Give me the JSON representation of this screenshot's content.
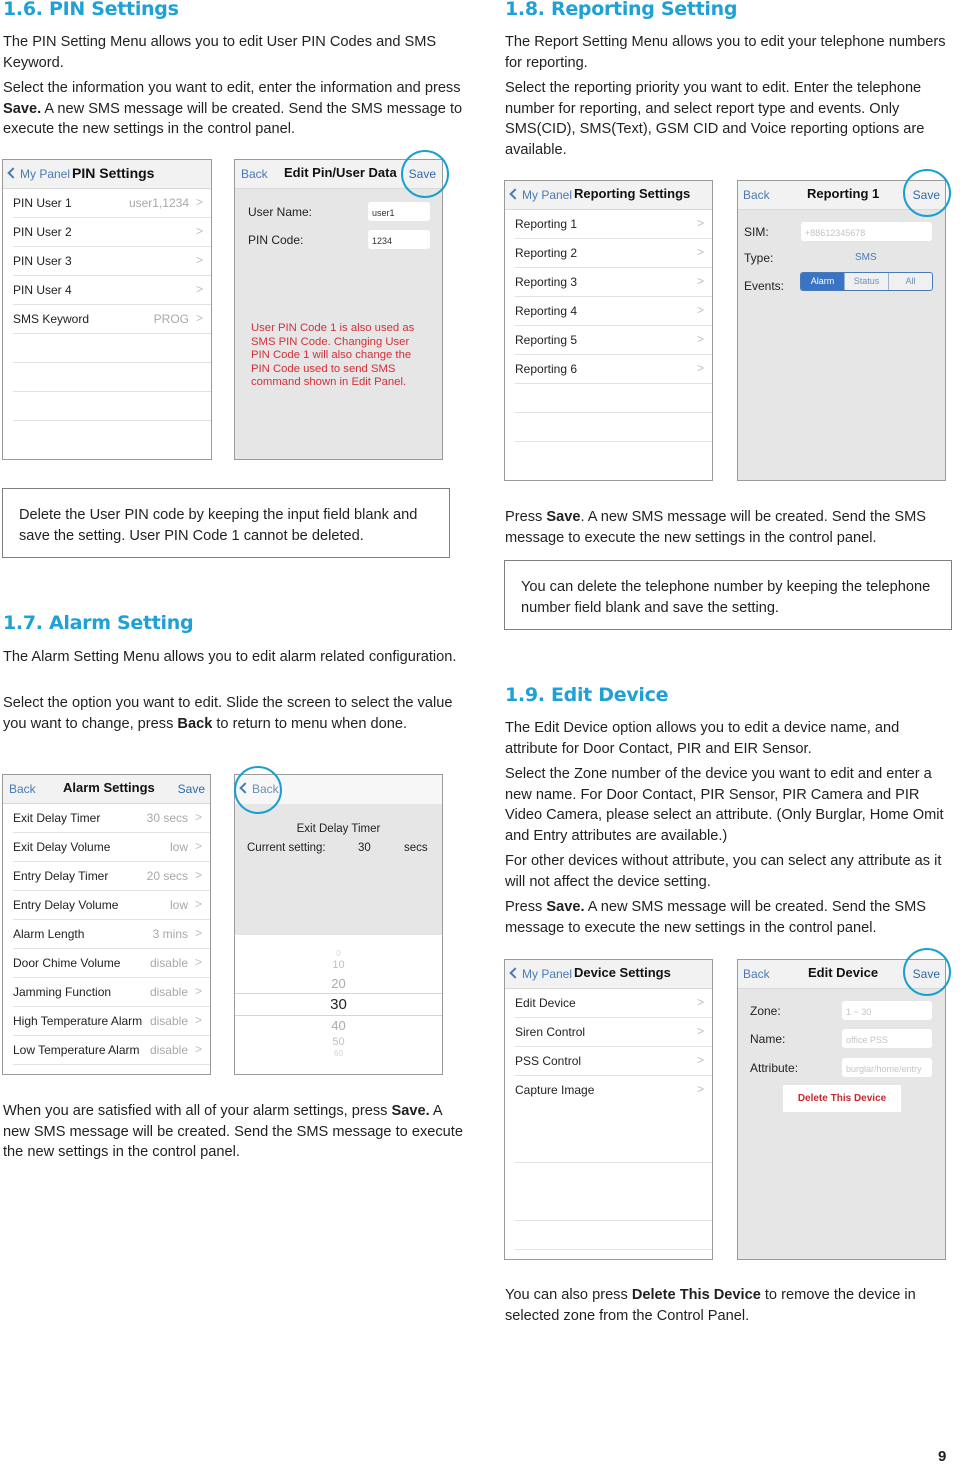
{
  "page_number": "9",
  "s16": {
    "heading": "1.6. PIN Settings",
    "para1": "The PIN Setting Menu allows you to edit User PIN Codes and SMS Keyword.",
    "para2_pre": "Select the information you want to edit, enter the information and press ",
    "para2_bold": "Save.",
    "para2_post": " A new SMS message will be created. Send the SMS message to execute the new settings in the control panel.",
    "note": "Delete the User PIN code by keeping the input field blank and save the setting. User PIN Code 1 cannot be deleted.",
    "list_screen": {
      "back": "My Panel",
      "title": "PIN Settings",
      "rows": [
        {
          "label": "PIN User 1",
          "value": "user1,1234"
        },
        {
          "label": "PIN User 2",
          "value": ""
        },
        {
          "label": "PIN User 3",
          "value": ""
        },
        {
          "label": "PIN User 4",
          "value": ""
        },
        {
          "label": "SMS Keyword",
          "value": "PROG"
        }
      ]
    },
    "edit_screen": {
      "back": "Back",
      "title": "Edit Pin/User Data",
      "save": "Save",
      "user_name_label": "User Name:",
      "user_name_value": "user1",
      "pin_code_label": "PIN Code:",
      "pin_code_value": "1234",
      "warning": "User PIN Code 1 is also used as SMS PIN Code. Changing User PIN Code 1 will also change the PIN Code used to send SMS command shown in Edit Panel."
    }
  },
  "s17": {
    "heading": "1.7. Alarm Setting",
    "para1": "The Alarm Setting Menu allows you to edit alarm related configuration.",
    "para2_pre": "Select the option you want to edit. Slide the screen to select the value you want to change, press ",
    "para2_bold": "Back",
    "para2_post": " to return to menu when done.",
    "after_pre": "When you are satisfied with all of your alarm settings, press ",
    "after_bold": "Save.",
    "after_post": " A new SMS message will be created. Send the SMS message to execute the new settings in the control panel.",
    "list_screen": {
      "back": "Back",
      "title": "Alarm Settings",
      "save": "Save",
      "rows": [
        {
          "label": "Exit Delay Timer",
          "value": "30 secs"
        },
        {
          "label": "Exit Delay Volume",
          "value": "low"
        },
        {
          "label": "Entry Delay Timer",
          "value": "20 secs"
        },
        {
          "label": "Entry Delay Volume",
          "value": "low"
        },
        {
          "label": "Alarm Length",
          "value": "3 mins"
        },
        {
          "label": "Door Chime Volume",
          "value": "disable"
        },
        {
          "label": "Jamming Function",
          "value": "disable"
        },
        {
          "label": "High Temperature Alarm",
          "value": "disable"
        },
        {
          "label": "Low Temperature Alarm",
          "value": "disable"
        }
      ]
    },
    "picker_screen": {
      "back": "Back",
      "title": "Exit Delay Timer",
      "current_label": "Current setting:",
      "current_value": "30",
      "unit": "secs",
      "options": [
        "0",
        "10",
        "20",
        "30",
        "40",
        "50",
        "60"
      ],
      "selected": "30"
    }
  },
  "s18": {
    "heading": "1.8. Reporting Setting",
    "para1": "The Report Setting Menu allows you to edit your telephone numbers for reporting.",
    "para2": "Select the reporting priority you want to edit. Enter the telephone number for reporting, and select report type and events. Only SMS(CID), SMS(Text), GSM CID and Voice reporting options are available.",
    "after_pre": "Press ",
    "after_bold": "Save",
    "after_post": ". A new SMS message will be created. Send the SMS message to execute the new settings in the control panel.",
    "note": "You can delete the telephone number by keeping the telephone number field blank and save the setting.",
    "list_screen": {
      "back": "My Panel",
      "title": "Reporting Settings",
      "rows": [
        "Reporting 1",
        "Reporting 2",
        "Reporting 3",
        "Reporting 4",
        "Reporting 5",
        "Reporting 6"
      ]
    },
    "edit_screen": {
      "back": "Back",
      "title": "Reporting 1",
      "save": "Save",
      "sim_label": "SIM:",
      "sim_placeholder": "+88612345678",
      "type_label": "Type:",
      "type_value": "SMS",
      "events_label": "Events:",
      "events_options": [
        "Alarm",
        "Status",
        "All"
      ],
      "events_selected": "Alarm",
      "accent_color": "#3a74c4"
    }
  },
  "s19": {
    "heading": "1.9. Edit Device",
    "para1": "The Edit Device option allows you to edit a device name, and attribute for Door Contact, PIR and EIR Sensor.",
    "para2": "Select the Zone number of the device you want to edit and enter a new name. For Door Contact, PIR Sensor, PIR Camera and PIR Video Camera, please select an attribute. (Only Burglar, Home Omit and Entry attributes are available.)",
    "para3": "For other devices without attribute, you can select any attribute as it will not affect the device setting.",
    "para4_pre": "Press ",
    "para4_bold": "Save.",
    "para4_post": " A new SMS message will be created. Send the SMS message to execute the new settings in the control panel.",
    "after_pre": "You can also press ",
    "after_bold": "Delete This Device",
    "after_post": " to remove the device in selected zone from the Control Panel.",
    "list_screen": {
      "back": "My Panel",
      "title": "Device Settings",
      "rows": [
        "Edit Device",
        "Siren Control",
        "PSS Control",
        "Capture Image"
      ]
    },
    "edit_screen": {
      "back": "Back",
      "title": "Edit Device",
      "save": "Save",
      "zone_label": "Zone:",
      "zone_placeholder": "1 ~ 30",
      "name_label": "Name:",
      "name_placeholder": "office PSS",
      "attribute_label": "Attribute:",
      "attribute_placeholder": "burglar/home/entry",
      "delete_button": "Delete This Device",
      "delete_color": "#c8282e"
    }
  },
  "colors": {
    "heading": "#1fa1d6",
    "highlight_ring": "#1aa0d0",
    "warning_text": "#d0313a",
    "nav_link": "#4a7ab5"
  }
}
